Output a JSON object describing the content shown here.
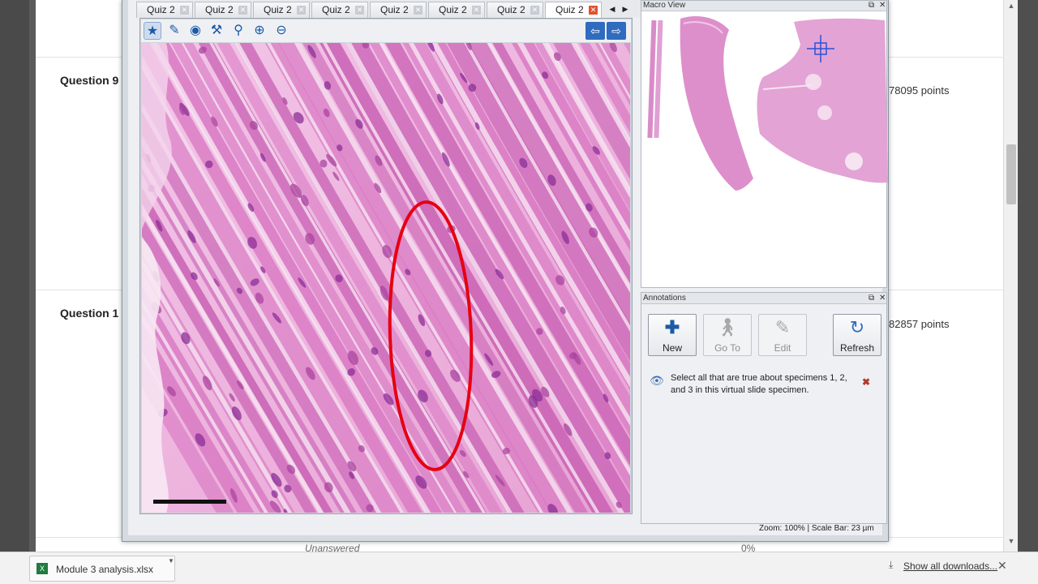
{
  "page": {
    "questions": [
      {
        "label": "Question 9",
        "points": "78095 points"
      },
      {
        "label": "Question 1",
        "points": "82857 points"
      }
    ],
    "unanswered": "Unanswered",
    "percent": "0%"
  },
  "viewer": {
    "tabs": [
      {
        "label": "Quiz 2",
        "close": "✕"
      },
      {
        "label": "Quiz 2",
        "close": "✕"
      },
      {
        "label": "Quiz 2",
        "close": "✕"
      },
      {
        "label": "Quiz 2",
        "close": "✕"
      },
      {
        "label": "Quiz 2",
        "close": "✕"
      },
      {
        "label": "Quiz 2",
        "close": "✕"
      },
      {
        "label": "Quiz 2",
        "close": "✕"
      },
      {
        "label": "Quiz 2",
        "close": "✕",
        "active": true
      }
    ],
    "toolbar_icons": [
      "star-icon",
      "draw-icon",
      "eye-icon",
      "wrench-icon",
      "magnifier-icon",
      "zoom-in-icon",
      "zoom-out-icon"
    ],
    "nav_icons": [
      "arrow-left-icon",
      "arrow-right-icon"
    ],
    "macro_panel": {
      "title": "Macro View"
    },
    "annotations_panel": {
      "title": "Annotations",
      "buttons": [
        {
          "label": "New",
          "icon": "plus-icon",
          "enabled": true
        },
        {
          "label": "Go To",
          "icon": "walk-icon",
          "enabled": false
        },
        {
          "label": "Edit",
          "icon": "pencil-icon",
          "enabled": false
        },
        {
          "label": "Refresh",
          "icon": "refresh-icon",
          "enabled": true
        }
      ],
      "items": [
        {
          "text": "Select all that are true about specimens 1, 2, and 3 in this virtual slide specimen."
        }
      ]
    },
    "status": "Zoom: 100% | Scale Bar: 23 µm"
  },
  "downloads": {
    "file": "Module 3 analysis.xlsx",
    "show_all": "Show all downloads..."
  },
  "colors": {
    "annotation_ring": "#e60012",
    "tissue_pink": "#d96fc0",
    "nuclei": "#7a2a8a",
    "accent_blue": "#2f6cc0"
  }
}
